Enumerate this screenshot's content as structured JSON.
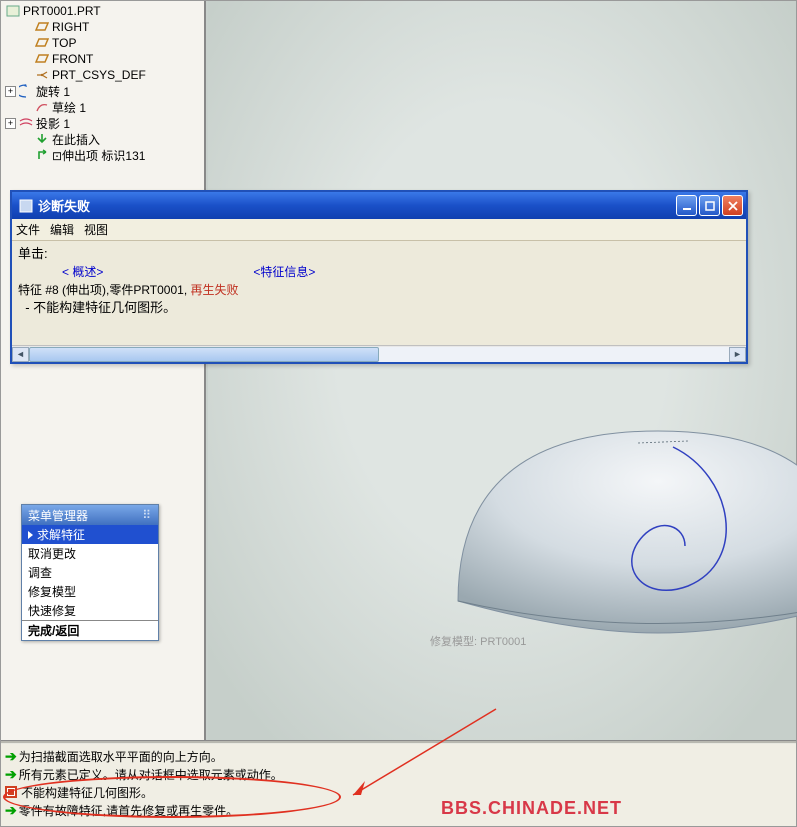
{
  "tree": {
    "root": "PRT0001.PRT",
    "items": [
      {
        "icon": "plane",
        "label": "RIGHT"
      },
      {
        "icon": "plane",
        "label": "TOP"
      },
      {
        "icon": "plane",
        "label": "FRONT"
      },
      {
        "icon": "csys",
        "label": "PRT_CSYS_DEF"
      },
      {
        "icon": "revolve",
        "label": "旋转 1",
        "exp": "+"
      },
      {
        "icon": "sketch",
        "label": "草绘 1"
      },
      {
        "icon": "project",
        "label": "投影 1",
        "exp": "+"
      },
      {
        "icon": "insert",
        "label": "在此插入"
      },
      {
        "icon": "protrude",
        "label": "⊡伸出项 标识131"
      }
    ]
  },
  "dialog": {
    "title": "诊断失败",
    "menu": {
      "file": "文件",
      "edit": "编辑",
      "view": "视图"
    },
    "click_label": "单击:",
    "link_overview": "< 概述>",
    "link_featinfo": "<特征信息>",
    "line_feat": "特征 #8 (伸出项),零件PRT0001, ",
    "line_feat_err": "再生失败",
    "line_detail": "  - 不能构建特征几何图形。"
  },
  "menumgr": {
    "title": "菜单管理器",
    "items": [
      "求解特征",
      "取消更改",
      "调查",
      "修复模型",
      "快速修复"
    ],
    "done": "完成/返回"
  },
  "viewport": {
    "model_label": "修复模型: PRT0001"
  },
  "messages": [
    {
      "icon": "green",
      "text": "为扫描截面选取水平平面的向上方向。"
    },
    {
      "icon": "green",
      "text": "所有元素已定义。请从对话框中选取元素或动作。"
    },
    {
      "icon": "redbox",
      "text": "不能构建特征几何图形。"
    },
    {
      "icon": "green",
      "text": "零件有故障特征,请首先修复或再生零件。"
    }
  ],
  "watermark": "BBS.CHINADE.NET"
}
